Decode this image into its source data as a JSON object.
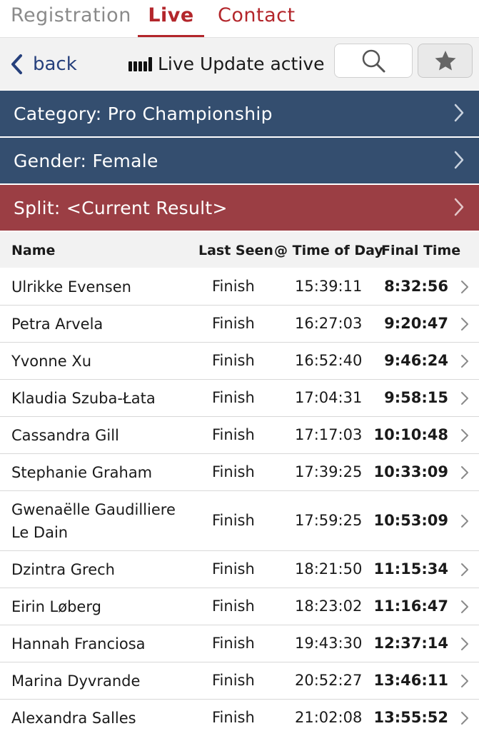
{
  "tabs": {
    "registration": "Registration",
    "live": "Live",
    "contact": "Contact"
  },
  "toolbar": {
    "back_label": "back",
    "live_update_label": "Live Update active",
    "search_icon": "search-icon",
    "star_icon": "star-icon"
  },
  "filters": {
    "category": "Category: Pro Championship",
    "gender": "Gender: Female",
    "split": "Split: <Current Result>"
  },
  "colors": {
    "accent_red": "#b3262b",
    "filter_blue": "#344e6f",
    "filter_red": "#9b3e44",
    "link_blue": "#26407c"
  },
  "table": {
    "headers": {
      "name": "Name",
      "last_seen": "Last Seen",
      "time_of_day": "@ Time of Day",
      "final_time": "Final Time"
    },
    "rows": [
      {
        "name": "Ulrikke Evensen",
        "last_seen": "Finish",
        "time_of_day": "15:39:11",
        "final_time": "8:32:56"
      },
      {
        "name": "Petra Arvela",
        "last_seen": "Finish",
        "time_of_day": "16:27:03",
        "final_time": "9:20:47"
      },
      {
        "name": "Yvonne Xu",
        "last_seen": "Finish",
        "time_of_day": "16:52:40",
        "final_time": "9:46:24"
      },
      {
        "name": "Klaudia Szuba-Łata",
        "last_seen": "Finish",
        "time_of_day": "17:04:31",
        "final_time": "9:58:15"
      },
      {
        "name": "Cassandra Gill",
        "last_seen": "Finish",
        "time_of_day": "17:17:03",
        "final_time": "10:10:48"
      },
      {
        "name": "Stephanie Graham",
        "last_seen": "Finish",
        "time_of_day": "17:39:25",
        "final_time": "10:33:09"
      },
      {
        "name": "Gwenaëlle Gaudilliere Le Dain",
        "last_seen": "Finish",
        "time_of_day": "17:59:25",
        "final_time": "10:53:09"
      },
      {
        "name": "Dzintra Grech",
        "last_seen": "Finish",
        "time_of_day": "18:21:50",
        "final_time": "11:15:34"
      },
      {
        "name": "Eirin Løberg",
        "last_seen": "Finish",
        "time_of_day": "18:23:02",
        "final_time": "11:16:47"
      },
      {
        "name": "Hannah Franciosa",
        "last_seen": "Finish",
        "time_of_day": "19:43:30",
        "final_time": "12:37:14"
      },
      {
        "name": "Marina Dyvrande",
        "last_seen": "Finish",
        "time_of_day": "20:52:27",
        "final_time": "13:46:11"
      },
      {
        "name": "Alexandra Salles",
        "last_seen": "Finish",
        "time_of_day": "21:02:08",
        "final_time": "13:55:52"
      }
    ]
  }
}
